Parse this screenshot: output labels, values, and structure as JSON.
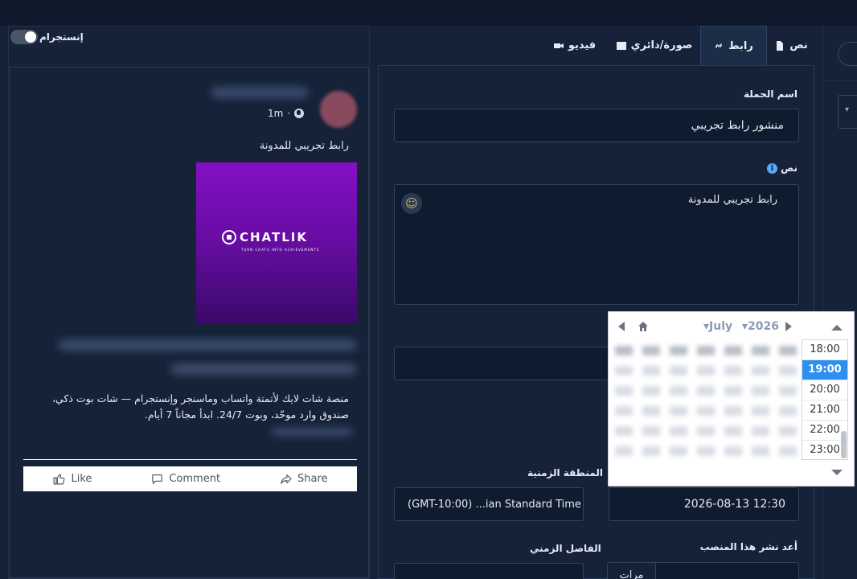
{
  "preview": {
    "instagram_toggle_label": "إنستجرام",
    "post_time": "1m",
    "post_text": "رابط تجريبي للمدونة",
    "image": {
      "logo_text": "CHATLIK",
      "tagline": "TURN CHATS INTO ACHIEVEMENTS"
    },
    "description": "منصة شات لايك لأتمتة واتساب وماسنجر وإنستجرام — شات بوت ذكي، صندوق وارد موحّد، وبوت 24/7. ابدأ مجاناً 7 أيام.",
    "actions": {
      "like": "Like",
      "comment": "Comment",
      "share": "Share"
    }
  },
  "tabs": [
    {
      "label": "نص",
      "icon": "file-icon"
    },
    {
      "label": "رابط",
      "icon": "link-icon"
    },
    {
      "label": "صورة/دائري",
      "icon": "image-icon"
    },
    {
      "label": "فيديو",
      "icon": "video-icon"
    }
  ],
  "form": {
    "campaign_name_label": "اسم الحملة",
    "campaign_name_value": "منشور رابط تجريبي",
    "text_label": "نص",
    "text_value": "رابط تجريبي للمدونة",
    "timezone_label": "المنطقة الزمنية",
    "timezone_value": "(GMT-10:00) ...ian Standard Time",
    "datetime_value": "2026-08-13 12:30",
    "interval_label": "الفاصل الزمني",
    "repost_label": "أعد نشر هذا المنصب",
    "repost_unit": "مرات"
  },
  "datepicker": {
    "month": "July",
    "year": "2026",
    "times": [
      "18:00",
      "19:00",
      "20:00",
      "21:00",
      "22:00",
      "23:00"
    ],
    "selected_time": "19:00"
  },
  "colors": {
    "accent": "#2d8ff0",
    "background": "#152238",
    "input_bg": "#0f1b2e",
    "image_purple": "#8310c4"
  }
}
